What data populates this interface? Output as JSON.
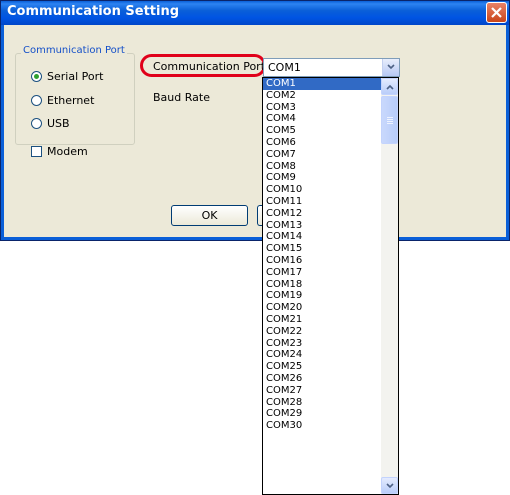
{
  "window": {
    "title": "Communication Setting"
  },
  "group": {
    "legend": "Communication Port",
    "options": [
      {
        "label": "Serial Port",
        "checked": true
      },
      {
        "label": "Ethernet",
        "checked": false
      },
      {
        "label": "USB",
        "checked": false
      }
    ]
  },
  "modem": {
    "label": "Modem",
    "checked": false
  },
  "fields": {
    "port_label": "Communication Port",
    "baud_label": "Baud Rate",
    "port_value": "COM1"
  },
  "buttons": {
    "ok": "OK"
  },
  "dropdown": {
    "selected": "COM1",
    "items": [
      "COM1",
      "COM2",
      "COM3",
      "COM4",
      "COM5",
      "COM6",
      "COM7",
      "COM8",
      "COM9",
      "COM10",
      "COM11",
      "COM12",
      "COM13",
      "COM14",
      "COM15",
      "COM16",
      "COM17",
      "COM18",
      "COM19",
      "COM20",
      "COM21",
      "COM22",
      "COM23",
      "COM24",
      "COM25",
      "COM26",
      "COM27",
      "COM28",
      "COM29",
      "COM30"
    ]
  },
  "colors": {
    "highlight": "#e0001a",
    "selection": "#316ac5",
    "titlebar": "#0054e3"
  },
  "icons": {
    "close": "close-icon",
    "combo": "chevron-down-icon",
    "scroll_up": "arrow-up-icon",
    "scroll_down": "arrow-down-icon"
  }
}
